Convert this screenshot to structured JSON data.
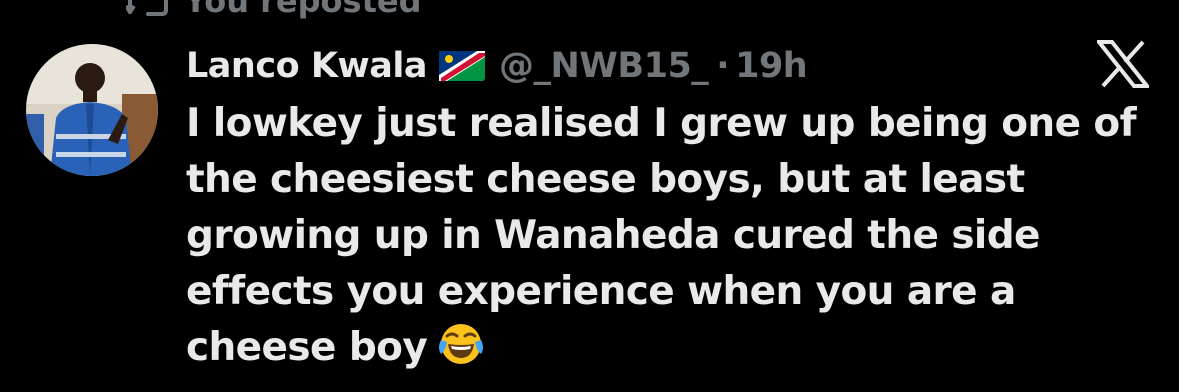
{
  "repost": {
    "label": "You reposted",
    "icon": "repost-icon"
  },
  "tweet": {
    "author": {
      "display_name": "Lanco Kwala",
      "flag": "namibia-flag-icon",
      "handle": "@_NWB15_",
      "avatar": "avatar-photo"
    },
    "separator": "·",
    "time": "19h",
    "text_lines": [
      "I lowkey just realised I grew up being one of",
      "the cheesiest cheese boys, but at least",
      "growing up in Wanaheda cured the side",
      "effects you experience when you are a",
      "cheese boy"
    ],
    "emoji": "face-with-tears-of-joy-icon"
  },
  "brand": {
    "logo": "x-logo-icon"
  },
  "colors": {
    "background": "#000000",
    "primary_text": "#e7e9ea",
    "secondary_text": "#71767b"
  }
}
